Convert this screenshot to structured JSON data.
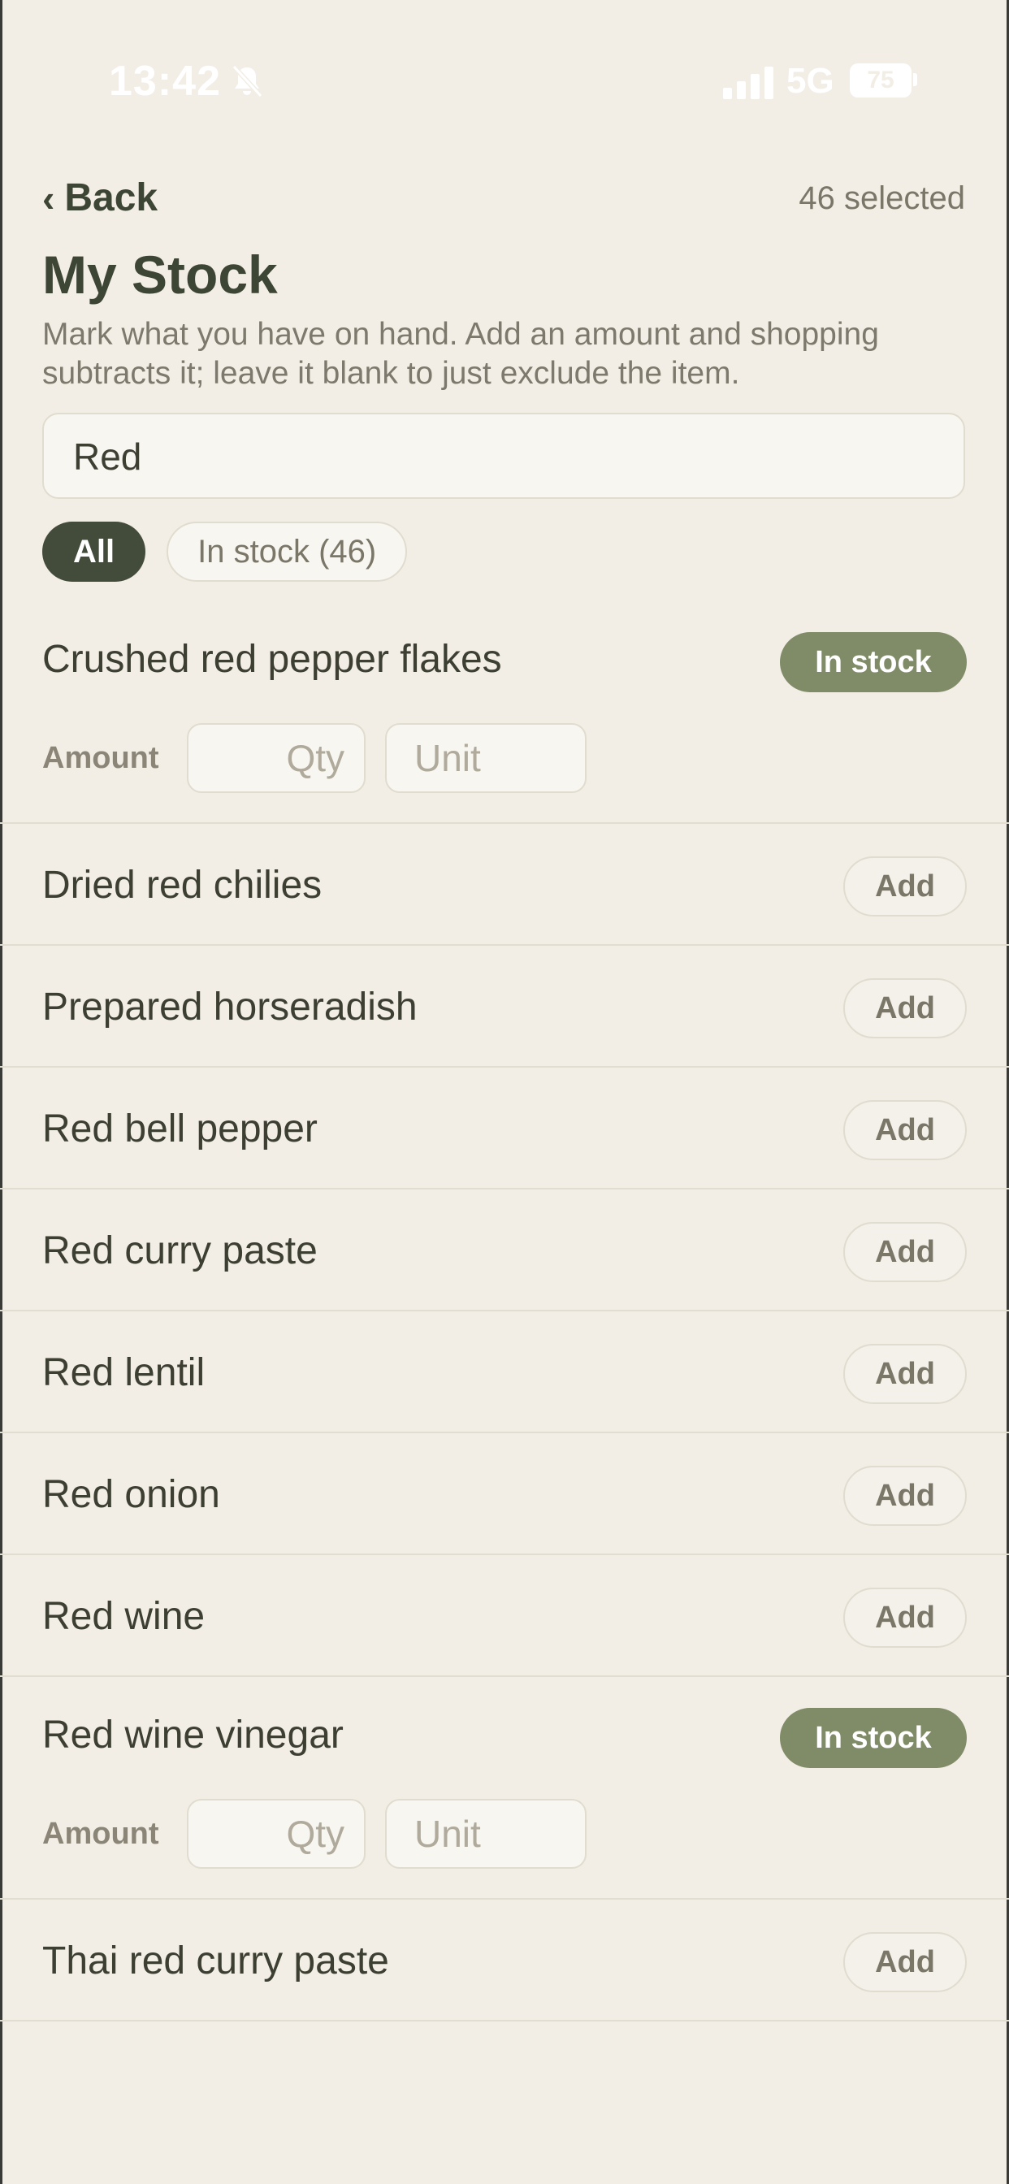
{
  "status_bar": {
    "time": "13:42",
    "network": "5G",
    "battery": "75",
    "icons": [
      "bell-muted-icon",
      "signal-icon",
      "battery-icon"
    ]
  },
  "header": {
    "back_label": "Back",
    "selected_count": "46 selected",
    "title": "My Stock",
    "subtitle": "Mark what you have on hand. Add an amount and shopping subtracts it; leave it blank to just exclude the item."
  },
  "search": {
    "value": "Red"
  },
  "filters": {
    "all_label": "All",
    "in_stock_label": "In stock (46)"
  },
  "items": [
    {
      "name": "Crushed red pepper flakes",
      "status": "In stock",
      "amount_label": "Amount",
      "qty_placeholder": "Qty",
      "unit_placeholder": "Unit"
    },
    {
      "name": "Dried red chilies",
      "action": "Add"
    },
    {
      "name": "Prepared horseradish",
      "action": "Add"
    },
    {
      "name": "Red bell pepper",
      "action": "Add"
    },
    {
      "name": "Red curry paste",
      "action": "Add"
    },
    {
      "name": "Red lentil",
      "action": "Add"
    },
    {
      "name": "Red onion",
      "action": "Add"
    },
    {
      "name": "Red wine",
      "action": "Add"
    },
    {
      "name": "Red wine vinegar",
      "status": "In stock",
      "amount_label": "Amount",
      "qty_placeholder": "Qty",
      "unit_placeholder": "Unit"
    },
    {
      "name": "Thai red curry paste",
      "action": "Add"
    }
  ],
  "colors": {
    "background": "#f2eee6",
    "accent_dark": "#434b3b",
    "in_stock_green": "#808c68"
  }
}
